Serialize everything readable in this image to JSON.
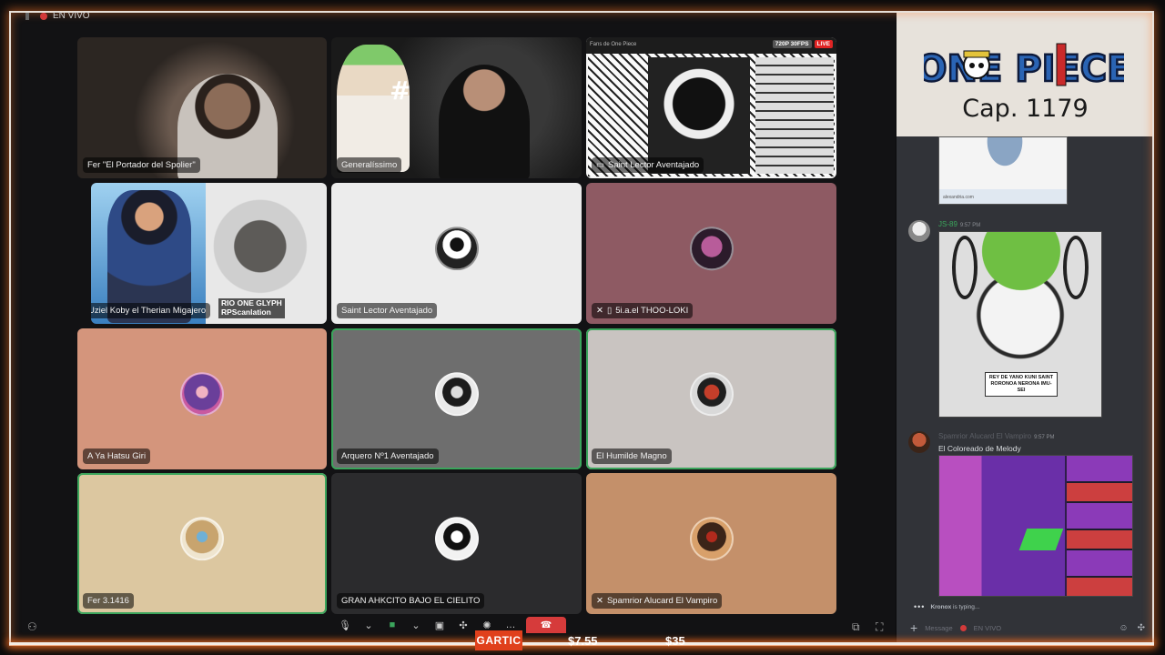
{
  "stream": {
    "live_label": "EN VIVO"
  },
  "tiles": [
    {
      "name": "Fer \"El Portador del Spolier\"",
      "avatar": "camera"
    },
    {
      "name": "Generalíssimo",
      "avatar": "camera"
    },
    {
      "name": "Saint Lector Aventajado",
      "avatar": "screen-share",
      "quality": "720P 30FPS",
      "live": "LIVE",
      "bar_title": "Fans de One Piece"
    },
    {
      "name": "Uziel Koby el Therian Migajero",
      "avatar": "camera",
      "watermark_1": "RIO ONE GLYPH",
      "watermark_2": "RPScanlation"
    },
    {
      "name": "Saint Lector Aventajado",
      "avatar": "wolf"
    },
    {
      "name": "5i.a.el THOO-LOKI",
      "avatar": "loki"
    },
    {
      "name": "A Ya Hatsu Giri",
      "avatar": "hatsu"
    },
    {
      "name": "Arquero Nº1 Aventajado",
      "avatar": "arquero"
    },
    {
      "name": "El Humilde Magno",
      "avatar": "humilde"
    },
    {
      "name": "Fer 3.1416",
      "avatar": "fer"
    },
    {
      "name": "GRAN AHKCITO BAJO EL CIELITO",
      "avatar": "gran"
    },
    {
      "name": "Spamrior Alucard El Vampiro",
      "avatar": "spam"
    }
  ],
  "ticker": {
    "game": "GARTIC",
    "price_1": "$7.55",
    "price_2": "$35"
  },
  "overlay": {
    "logo_text": "ONE PIECE",
    "chapter": "Cap. 1179"
  },
  "chat": {
    "messages": [
      {
        "author": "JS-89",
        "time": "9:57 PM",
        "author_color": "#3ba55c"
      },
      {
        "author": "Spamrior Alucard El Vampiro",
        "time": "9:57 PM",
        "text": "El Coloreado de Melody",
        "author_color": "#8a8d93"
      }
    ],
    "zoro_caption": "REY DE YANO KUNI SAINT RORONOA NERONA IMU-SEI",
    "top_image_url": "alexandria.com",
    "typing_user": "Kronox",
    "typing_suffix": "is typing...",
    "input_placeholder": "Message",
    "input_channel": "EN VIVO"
  }
}
